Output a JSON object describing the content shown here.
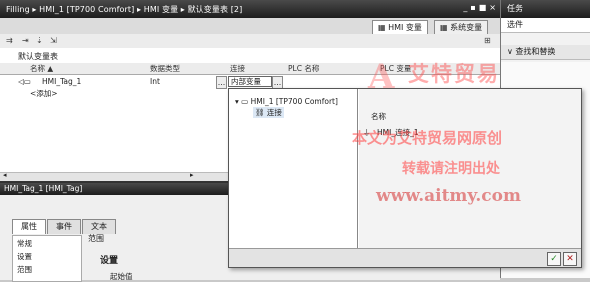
{
  "window": {
    "title": "Filling  ▸ HMI_1 [TP700 Comfort]  ▸ HMI 变量  ▸ 默认变量表 [2]",
    "controls": [
      "_",
      "▪",
      "■",
      "×"
    ]
  },
  "right_panel": {
    "title": "任务",
    "options_label": "选件",
    "find_replace": "查找和替换"
  },
  "tabs": [
    {
      "label": "HMI 变量",
      "active": true
    },
    {
      "label": "系统变量",
      "active": false
    }
  ],
  "table": {
    "title": "默认变量表",
    "columns": [
      "名称 ▲",
      "数据类型",
      "连接",
      "PLC 名称",
      "PLC 变量"
    ],
    "rows": [
      {
        "name": "HMI_Tag_1",
        "type": "Int",
        "connection": "内部变量",
        "plc_name": "",
        "plc_tag": ""
      }
    ],
    "add_row": "<添加>"
  },
  "popup": {
    "tree_root": "HMI_1 [TP700 Comfort]",
    "tree_child": "连接",
    "right_header": "名称",
    "right_item": "HMI_连接_1",
    "ok_label": "✓",
    "cancel_label": "✕"
  },
  "properties": {
    "title": "HMI_Tag_1 [HMI_Tag]",
    "tabs": [
      "属性",
      "事件",
      "文本"
    ],
    "left_items": [
      "常规",
      "设置",
      "范围"
    ],
    "section_title": "范围",
    "settings_title": "设置",
    "settings_sub": "起始值"
  },
  "watermark": {
    "logo_letter": "A",
    "brand": "艾特贸易",
    "line1": "本文为艾特贸易网原创",
    "line2": "转载请注明出处",
    "url": "www.aitmy.com"
  }
}
